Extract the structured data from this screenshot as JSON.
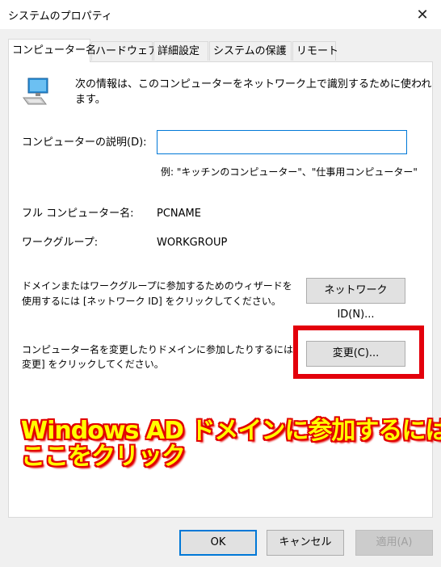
{
  "window": {
    "title": "システムのプロパティ",
    "close_glyph": "✕"
  },
  "tabs": [
    {
      "label": "コンピューター名",
      "active": true
    },
    {
      "label": "ハードウェア"
    },
    {
      "label": "詳細設定"
    },
    {
      "label": "システムの保護"
    },
    {
      "label": "リモート"
    }
  ],
  "panel": {
    "icon": "computer-icon",
    "intro_line1": "次の情報は、このコンピューターをネットワーク上で識別するために使われ",
    "intro_line2": "ます。",
    "desc_label": "コンピューターの説明(D):",
    "desc_value": "",
    "example": "例: \"キッチンのコンピューター\"、\"仕事用コンピューター\"",
    "fullname_label": "フル コンピューター名:",
    "fullname_value": "PCNAME",
    "workgroup_label": "ワークグループ:",
    "workgroup_value": "WORKGROUP",
    "wizard_line1": "ドメインまたはワークグループに参加するためのウィザードを",
    "wizard_line2": "使用するには [ネットワーク ID] をクリックしてください。",
    "network_id_button": "ネットワーク ID(N)...",
    "rename_line1": "コンピューター名を変更したりドメインに参加したりするには",
    "rename_line2": "変更] をクリックしてください。",
    "change_button": "変更(C)..."
  },
  "annotation": {
    "line1": "Windows AD ドメインに参加するには",
    "line2": "ここをクリック",
    "highlight_color": "#e3000b",
    "text_color": "#ffff00"
  },
  "buttons": {
    "ok": "OK",
    "cancel": "キャンセル",
    "apply": "適用(A)"
  }
}
